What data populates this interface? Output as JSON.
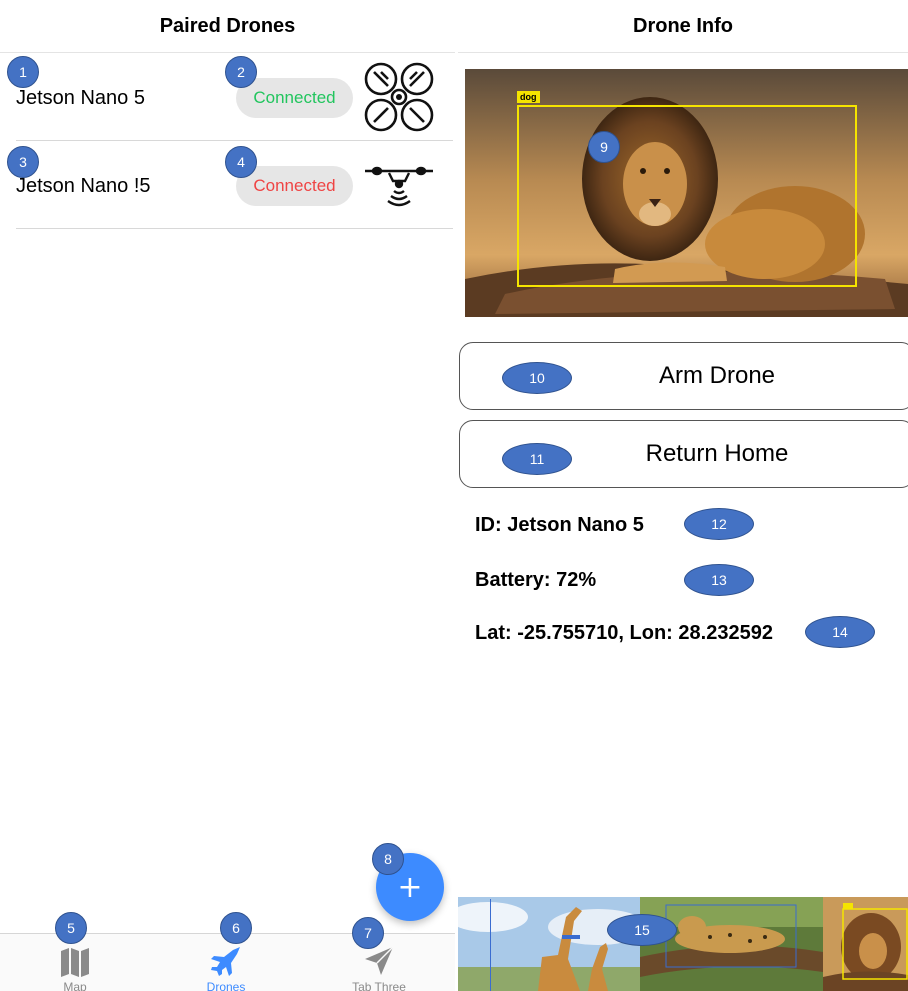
{
  "left": {
    "title": "Paired Drones",
    "drones": [
      {
        "name": "Jetson Nano 5",
        "status": "Connected",
        "status_color": "#22c55e",
        "icon": "quadcopter-icon"
      },
      {
        "name": "Jetson Nano !5",
        "status": "Connected",
        "status_color": "#ef4444",
        "icon": "drone-signal-icon"
      }
    ],
    "fab_label": "+",
    "tabs": [
      {
        "label": "Map",
        "icon": "map-icon",
        "active": false
      },
      {
        "label": "Drones",
        "icon": "jet-icon",
        "active": true
      },
      {
        "label": "Tab Three",
        "icon": "paper-plane-icon",
        "active": false
      }
    ]
  },
  "right": {
    "title": "Drone Info",
    "camera": {
      "detection_label": "dog",
      "box_color": "#f5e400"
    },
    "buttons": {
      "arm": "Arm Drone",
      "home": "Return Home"
    },
    "info": {
      "id": "ID: Jetson Nano 5",
      "battery": "Battery: 72%",
      "location": "Lat: -25.755710, Lon: 28.232592"
    }
  },
  "badges": [
    "1",
    "2",
    "3",
    "4",
    "5",
    "6",
    "7",
    "8",
    "9",
    "10",
    "11",
    "12",
    "13",
    "14",
    "15"
  ],
  "colors": {
    "accent": "#3d8bff",
    "badge": "#4472c4"
  }
}
